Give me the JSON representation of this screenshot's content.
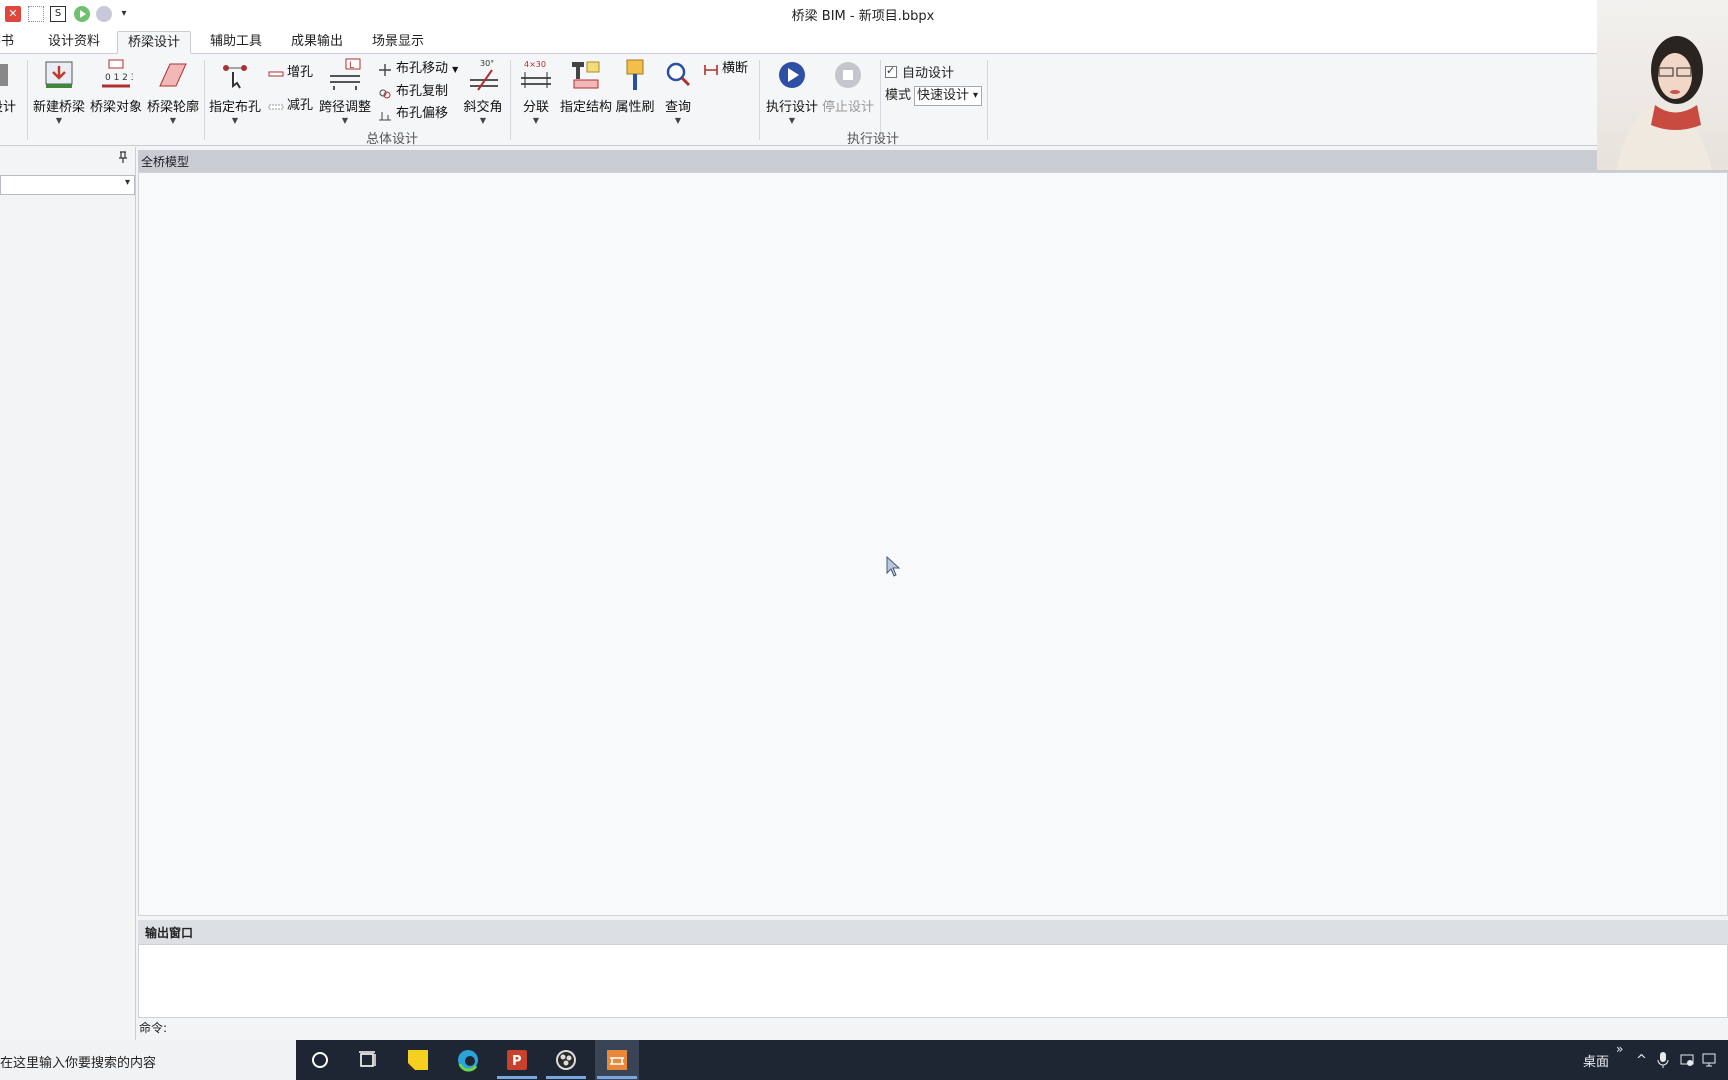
{
  "window": {
    "title": "桥梁 BIM - 新项目.bbpx"
  },
  "quick_access": {
    "close_glyph": "✕",
    "save_glyph": "S",
    "more_glyph": "▾"
  },
  "tabs": [
    {
      "label": "导书"
    },
    {
      "label": "设计资料"
    },
    {
      "label": "桥梁设计"
    },
    {
      "label": "辅助工具"
    },
    {
      "label": "成果输出"
    },
    {
      "label": "场景显示"
    }
  ],
  "ribbon": {
    "partial_left_label": "设计",
    "buttons": {
      "new_bridge": "新建桥梁",
      "bridge_object": "桥梁对象",
      "bridge_outline": "桥梁轮廓",
      "assign_holes": "指定布孔",
      "add_hole": "增孔",
      "remove_hole": "减孔",
      "span_adjust": "跨径调整",
      "hole_move": "布孔移动",
      "hole_copy": "布孔复制",
      "hole_offset": "布孔偏移",
      "skew_angle": "斜交角",
      "split": "分联",
      "assign_structure": "指定结构",
      "property_brush": "属性刷",
      "query": "查询",
      "cross_section": "横断",
      "execute_design": "执行设计",
      "stop_design": "停止设计"
    },
    "groups": {
      "overall_design": "总体设计",
      "execute_design": "执行设计"
    },
    "auto_design": {
      "label": "自动设计",
      "checked": true
    },
    "mode": {
      "label": "模式",
      "value": "快速设计"
    },
    "icon_text": {
      "split": "4×30",
      "skew": "30°",
      "span": "L"
    }
  },
  "left_panel": {
    "pin_glyph": "📌"
  },
  "model_view": {
    "title": "全桥模型"
  },
  "output": {
    "title": "输出窗口",
    "command_label": "命令:"
  },
  "taskbar": {
    "search_placeholder": "在这里输入你要搜索的内容",
    "desktop_label": "桌面",
    "overflow_glyph": "»",
    "up_glyph": "^"
  },
  "colors": {
    "accent": "#2b4fa0",
    "play": "#2e4fa6",
    "taskbar": "#1f2633"
  }
}
